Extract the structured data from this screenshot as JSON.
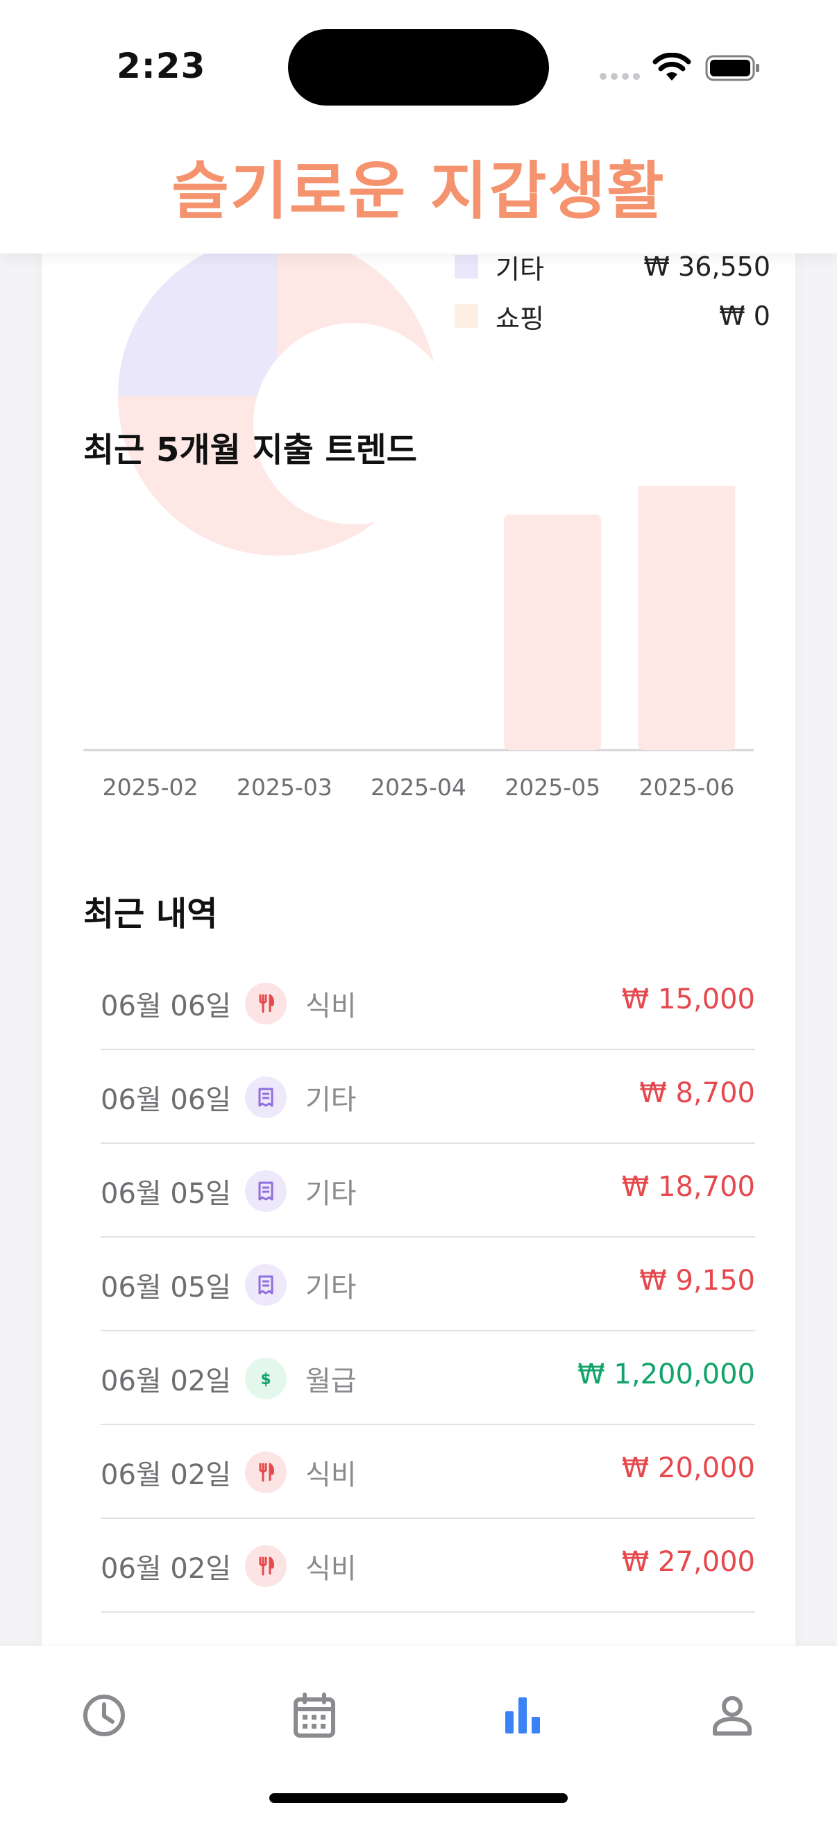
{
  "status_bar": {
    "time": "2:23"
  },
  "header": {
    "title": "슬기로운 지갑생활"
  },
  "colors": {
    "accent": "#f4936e",
    "expense": "#e5484d",
    "income": "#12a36b",
    "tab_active": "#3b82f6",
    "tab_inactive": "#8a8a8f"
  },
  "legend": [
    {
      "label": "기타",
      "value": "₩ 36,550",
      "color": "#ebe7fb"
    },
    {
      "label": "쇼핑",
      "value": "₩ 0",
      "color": "#fdefe3"
    }
  ],
  "trend": {
    "title": "최근 5개월 지출 트렌드"
  },
  "chart_data": {
    "type": "bar",
    "title": "최근 5개월 지출 트렌드",
    "categories": [
      "2025-02",
      "2025-03",
      "2025-04",
      "2025-05",
      "2025-06"
    ],
    "values": [
      0,
      0,
      0,
      0.87,
      1.0
    ],
    "value_scale": "relative to max",
    "bar_color": "#fde8e6",
    "grid": false
  },
  "recent": {
    "title": "최근 내역",
    "items": [
      {
        "date": "06월 06일",
        "icon": "fork-knife-icon",
        "category": "식비",
        "amount": "₩ 15,000",
        "type": "expense"
      },
      {
        "date": "06월 06일",
        "icon": "receipt-icon",
        "category": "기타",
        "amount": "₩ 8,700",
        "type": "expense"
      },
      {
        "date": "06월 05일",
        "icon": "receipt-icon",
        "category": "기타",
        "amount": "₩ 18,700",
        "type": "expense"
      },
      {
        "date": "06월 05일",
        "icon": "receipt-icon",
        "category": "기타",
        "amount": "₩ 9,150",
        "type": "expense"
      },
      {
        "date": "06월 02일",
        "icon": "dollar-icon",
        "category": "월급",
        "amount": "₩ 1,200,000",
        "type": "income"
      },
      {
        "date": "06월 02일",
        "icon": "fork-knife-icon",
        "category": "식비",
        "amount": "₩ 20,000",
        "type": "expense"
      },
      {
        "date": "06월 02일",
        "icon": "fork-knife-icon",
        "category": "식비",
        "amount": "₩ 27,000",
        "type": "expense"
      }
    ]
  },
  "tabs": [
    {
      "icon": "clock-icon",
      "active": false
    },
    {
      "icon": "calendar-icon",
      "active": false
    },
    {
      "icon": "bar-chart-icon",
      "active": true
    },
    {
      "icon": "person-icon",
      "active": false
    }
  ]
}
